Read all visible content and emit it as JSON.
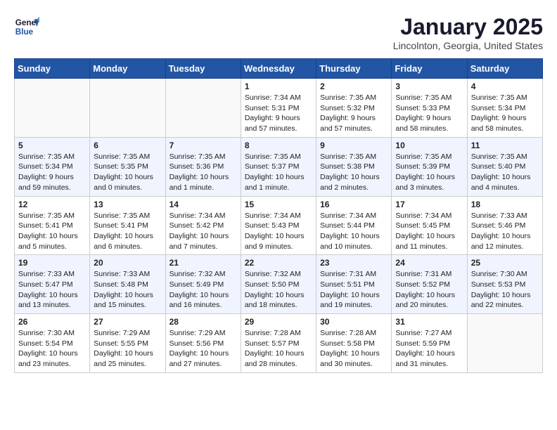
{
  "header": {
    "logo_line1": "General",
    "logo_line2": "Blue",
    "month": "January 2025",
    "location": "Lincolnton, Georgia, United States"
  },
  "weekdays": [
    "Sunday",
    "Monday",
    "Tuesday",
    "Wednesday",
    "Thursday",
    "Friday",
    "Saturday"
  ],
  "weeks": [
    [
      {
        "day": "",
        "info": ""
      },
      {
        "day": "",
        "info": ""
      },
      {
        "day": "",
        "info": ""
      },
      {
        "day": "1",
        "info": "Sunrise: 7:34 AM\nSunset: 5:31 PM\nDaylight: 9 hours\nand 57 minutes."
      },
      {
        "day": "2",
        "info": "Sunrise: 7:35 AM\nSunset: 5:32 PM\nDaylight: 9 hours\nand 57 minutes."
      },
      {
        "day": "3",
        "info": "Sunrise: 7:35 AM\nSunset: 5:33 PM\nDaylight: 9 hours\nand 58 minutes."
      },
      {
        "day": "4",
        "info": "Sunrise: 7:35 AM\nSunset: 5:34 PM\nDaylight: 9 hours\nand 58 minutes."
      }
    ],
    [
      {
        "day": "5",
        "info": "Sunrise: 7:35 AM\nSunset: 5:34 PM\nDaylight: 9 hours\nand 59 minutes."
      },
      {
        "day": "6",
        "info": "Sunrise: 7:35 AM\nSunset: 5:35 PM\nDaylight: 10 hours\nand 0 minutes."
      },
      {
        "day": "7",
        "info": "Sunrise: 7:35 AM\nSunset: 5:36 PM\nDaylight: 10 hours\nand 1 minute."
      },
      {
        "day": "8",
        "info": "Sunrise: 7:35 AM\nSunset: 5:37 PM\nDaylight: 10 hours\nand 1 minute."
      },
      {
        "day": "9",
        "info": "Sunrise: 7:35 AM\nSunset: 5:38 PM\nDaylight: 10 hours\nand 2 minutes."
      },
      {
        "day": "10",
        "info": "Sunrise: 7:35 AM\nSunset: 5:39 PM\nDaylight: 10 hours\nand 3 minutes."
      },
      {
        "day": "11",
        "info": "Sunrise: 7:35 AM\nSunset: 5:40 PM\nDaylight: 10 hours\nand 4 minutes."
      }
    ],
    [
      {
        "day": "12",
        "info": "Sunrise: 7:35 AM\nSunset: 5:41 PM\nDaylight: 10 hours\nand 5 minutes."
      },
      {
        "day": "13",
        "info": "Sunrise: 7:35 AM\nSunset: 5:41 PM\nDaylight: 10 hours\nand 6 minutes."
      },
      {
        "day": "14",
        "info": "Sunrise: 7:34 AM\nSunset: 5:42 PM\nDaylight: 10 hours\nand 7 minutes."
      },
      {
        "day": "15",
        "info": "Sunrise: 7:34 AM\nSunset: 5:43 PM\nDaylight: 10 hours\nand 9 minutes."
      },
      {
        "day": "16",
        "info": "Sunrise: 7:34 AM\nSunset: 5:44 PM\nDaylight: 10 hours\nand 10 minutes."
      },
      {
        "day": "17",
        "info": "Sunrise: 7:34 AM\nSunset: 5:45 PM\nDaylight: 10 hours\nand 11 minutes."
      },
      {
        "day": "18",
        "info": "Sunrise: 7:33 AM\nSunset: 5:46 PM\nDaylight: 10 hours\nand 12 minutes."
      }
    ],
    [
      {
        "day": "19",
        "info": "Sunrise: 7:33 AM\nSunset: 5:47 PM\nDaylight: 10 hours\nand 13 minutes."
      },
      {
        "day": "20",
        "info": "Sunrise: 7:33 AM\nSunset: 5:48 PM\nDaylight: 10 hours\nand 15 minutes."
      },
      {
        "day": "21",
        "info": "Sunrise: 7:32 AM\nSunset: 5:49 PM\nDaylight: 10 hours\nand 16 minutes."
      },
      {
        "day": "22",
        "info": "Sunrise: 7:32 AM\nSunset: 5:50 PM\nDaylight: 10 hours\nand 18 minutes."
      },
      {
        "day": "23",
        "info": "Sunrise: 7:31 AM\nSunset: 5:51 PM\nDaylight: 10 hours\nand 19 minutes."
      },
      {
        "day": "24",
        "info": "Sunrise: 7:31 AM\nSunset: 5:52 PM\nDaylight: 10 hours\nand 20 minutes."
      },
      {
        "day": "25",
        "info": "Sunrise: 7:30 AM\nSunset: 5:53 PM\nDaylight: 10 hours\nand 22 minutes."
      }
    ],
    [
      {
        "day": "26",
        "info": "Sunrise: 7:30 AM\nSunset: 5:54 PM\nDaylight: 10 hours\nand 23 minutes."
      },
      {
        "day": "27",
        "info": "Sunrise: 7:29 AM\nSunset: 5:55 PM\nDaylight: 10 hours\nand 25 minutes."
      },
      {
        "day": "28",
        "info": "Sunrise: 7:29 AM\nSunset: 5:56 PM\nDaylight: 10 hours\nand 27 minutes."
      },
      {
        "day": "29",
        "info": "Sunrise: 7:28 AM\nSunset: 5:57 PM\nDaylight: 10 hours\nand 28 minutes."
      },
      {
        "day": "30",
        "info": "Sunrise: 7:28 AM\nSunset: 5:58 PM\nDaylight: 10 hours\nand 30 minutes."
      },
      {
        "day": "31",
        "info": "Sunrise: 7:27 AM\nSunset: 5:59 PM\nDaylight: 10 hours\nand 31 minutes."
      },
      {
        "day": "",
        "info": ""
      }
    ]
  ]
}
